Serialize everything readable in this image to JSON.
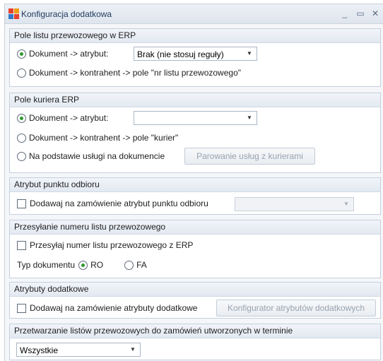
{
  "window": {
    "title": "Konfiguracja dodatkowa",
    "minimize": "_",
    "maximize": "▭",
    "close": "✕"
  },
  "colors": {
    "radio_selected": "#2f9a2f",
    "section_border": "#c5d0dd",
    "title_text": "#1e3a5f"
  },
  "icons": [
    "app-logo-icon",
    "minimize-icon",
    "maximize-icon",
    "close-icon",
    "chevron-down-icon"
  ],
  "section1": {
    "header": "Pole listu przewozowego w ERP",
    "opt1_label": "Dokument -> atrybut:",
    "opt1_selected": true,
    "select_value": "Brak (nie stosuj reguły)",
    "opt2_label": "Dokument -> kontrahent -> pole \"nr listu przewozowego\""
  },
  "section2": {
    "header": "Pole kuriera ERP",
    "opt1_label": "Dokument -> atrybut:",
    "opt1_selected": true,
    "select_value": "",
    "opt2_label": "Dokument -> kontrahent -> pole \"kurier\"",
    "opt3_label": "Na podstawie usługi na dokumencie",
    "button_label": "Parowanie usług z kurierami"
  },
  "section3": {
    "header": "Atrybut punktu odbioru",
    "checkbox_label": "Dodawaj na zamówienie atrybut punktu odbioru",
    "checked": false,
    "select_value": ""
  },
  "section4": {
    "header": "Przesyłanie numeru listu przewozowego",
    "checkbox_label": "Przesyłaj numer listu przewozowego z ERP",
    "checked": false,
    "doc_type_label": "Typ dokumentu",
    "opt_ro": "RO",
    "opt_fa": "FA",
    "selected": "RO"
  },
  "section5": {
    "header": "Atrybuty dodatkowe",
    "checkbox_label": "Dodawaj na zamówienie atrybuty dodatkowe",
    "checked": false,
    "button_label": "Konfigurator atrybutów dodatkowych"
  },
  "section6": {
    "header": "Przetwarzanie listów przewozowych do zamówień utworzonych w terminie",
    "select_value": "Wszystkie"
  }
}
